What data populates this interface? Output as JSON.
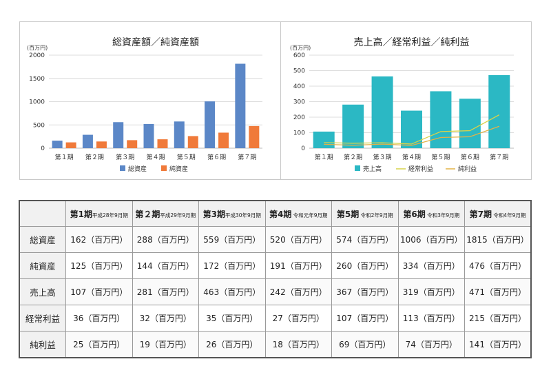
{
  "chart_data": [
    {
      "type": "bar",
      "title": "総資産額／純資産額",
      "unit": "(百万円)",
      "categories": [
        "第１期",
        "第２期",
        "第３期",
        "第４期",
        "第５期",
        "第６期",
        "第７期"
      ],
      "series": [
        {
          "name": "総資産",
          "values": [
            162,
            288,
            559,
            520,
            574,
            1006,
            1815
          ],
          "color": "#5b87c7"
        },
        {
          "name": "純資産",
          "values": [
            125,
            144,
            172,
            191,
            260,
            334,
            476
          ],
          "color": "#f07a3a"
        }
      ],
      "ylim": [
        0,
        2000
      ],
      "yticks": [
        "0",
        "500",
        "1000",
        "1500",
        "2000"
      ],
      "grid": true,
      "legend": "bottom"
    },
    {
      "type": "bar+line",
      "title": "売上高／経常利益／純利益",
      "unit": "(百万円)",
      "categories": [
        "第１期",
        "第２期",
        "第３期",
        "第４期",
        "第５期",
        "第６期",
        "第７期"
      ],
      "series": [
        {
          "name": "売上高",
          "type": "bar",
          "values": [
            107,
            281,
            463,
            242,
            367,
            319,
            471
          ],
          "color": "#2bb8c4"
        },
        {
          "name": "経常利益",
          "type": "line",
          "values": [
            36,
            32,
            35,
            27,
            107,
            113,
            215
          ],
          "color": "#d7d24a"
        },
        {
          "name": "純利益",
          "type": "line",
          "values": [
            25,
            19,
            26,
            18,
            69,
            74,
            141
          ],
          "color": "#e2b247"
        }
      ],
      "ylim": [
        0,
        600
      ],
      "yticks": [
        "0",
        "100",
        "200",
        "300",
        "400",
        "500",
        "600"
      ],
      "grid": true,
      "legend": "bottom"
    }
  ],
  "table": {
    "headers": [
      {
        "period": "第1期",
        "era": "平成28年9月期"
      },
      {
        "period": "第２期",
        "era": "平成29年9月期"
      },
      {
        "period": "第3期",
        "era": "平成30年9月期"
      },
      {
        "period": "第4期",
        "era": " 令和元年9月期"
      },
      {
        "period": "第5期",
        "era": " 令和2年9月期"
      },
      {
        "period": "第6期",
        "era": " 令和3年9月期"
      },
      {
        "period": "第7期",
        "era": " 令和4年9月期"
      }
    ],
    "rows": [
      {
        "label": "総資産",
        "cells": [
          "162（百万円）",
          "288（百万円）",
          "559（百万円）",
          "520（百万円）",
          "574（百万円）",
          "1006（百万円）",
          "1815（百万円）"
        ]
      },
      {
        "label": "純資産",
        "cells": [
          "125（百万円）",
          "144（百万円）",
          "172（百万円）",
          "191（百万円）",
          "260（百万円）",
          "334（百万円）",
          "476（百万円）"
        ]
      },
      {
        "label": "売上高",
        "cells": [
          "107（百万円）",
          "281（百万円）",
          "463（百万円）",
          "242（百万円）",
          "367（百万円）",
          "319（百万円）",
          "471（百万円）"
        ]
      },
      {
        "label": "経常利益",
        "cells": [
          "36（百万円）",
          "32（百万円）",
          "35（百万円）",
          "27（百万円）",
          "107（百万円）",
          "113（百万円）",
          "215（百万円）"
        ]
      },
      {
        "label": "純利益",
        "cells": [
          "25（百万円）",
          "19（百万円）",
          "26（百万円）",
          "18（百万円）",
          "69（百万円）",
          "74（百万円）",
          "141（百万円）"
        ]
      }
    ]
  }
}
